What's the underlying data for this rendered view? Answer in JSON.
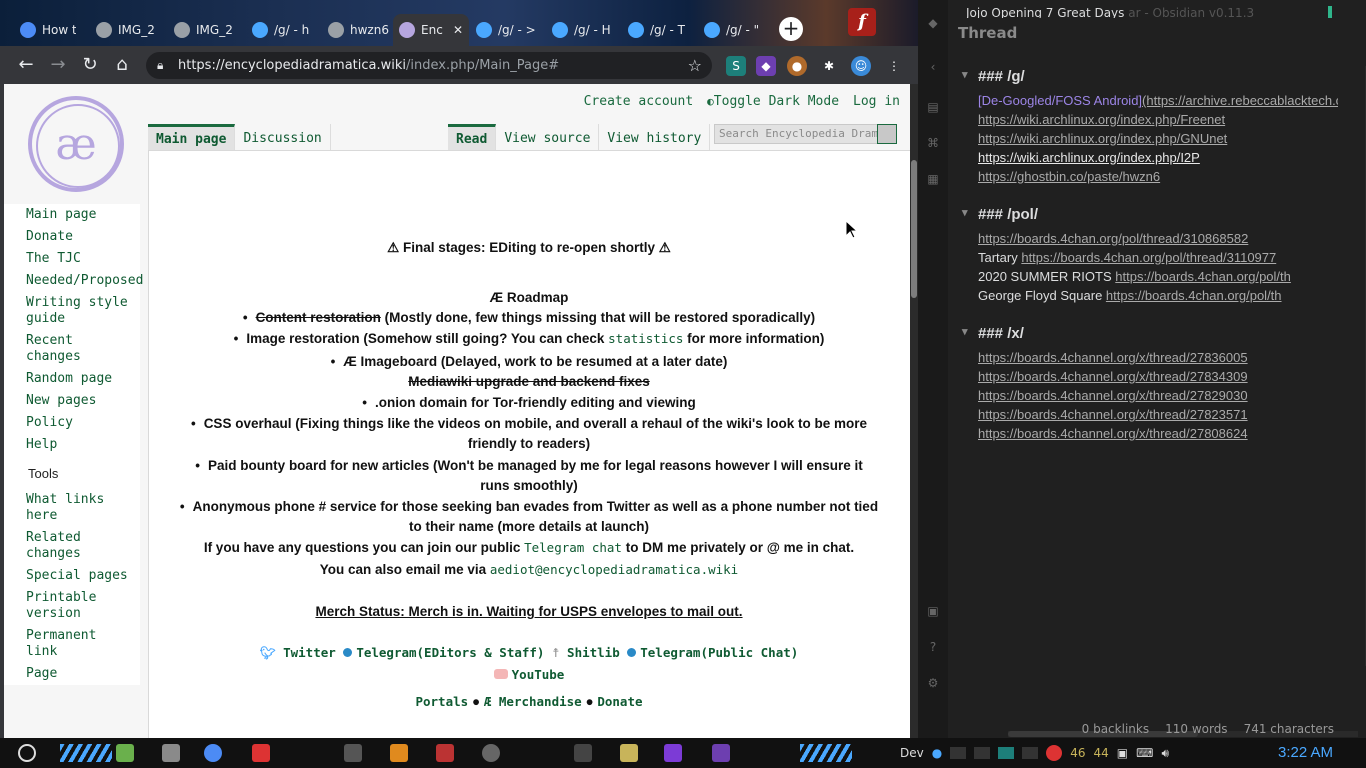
{
  "tabs": [
    {
      "title": "How to",
      "icon": "chrome-icon",
      "color": "#4c8bf5"
    },
    {
      "title": "IMG_2",
      "icon": "globe-icon",
      "color": "#9aa0a6"
    },
    {
      "title": "IMG_2",
      "icon": "globe-icon",
      "color": "#9aa0a6"
    },
    {
      "title": "/g/ - h",
      "icon": "4chan-icon",
      "color": "#4aa8ff"
    },
    {
      "title": "hwzn6",
      "icon": "ghost-icon",
      "color": "#9aa0a6"
    },
    {
      "title": "Enc",
      "icon": "ae-icon",
      "color": "#b6a6df",
      "active": true
    },
    {
      "title": "/g/ - >",
      "icon": "4chan-icon",
      "color": "#4aa8ff"
    },
    {
      "title": "/g/ - H",
      "icon": "4chan-icon",
      "color": "#4aa8ff"
    },
    {
      "title": "/g/ - T",
      "icon": "4chan-icon",
      "color": "#4aa8ff"
    },
    {
      "title": "/g/ - \"",
      "icon": "4chan-icon",
      "color": "#4aa8ff"
    }
  ],
  "address": {
    "host": "https://encyclopediadramatica.wiki",
    "path": "/index.php/Main_Page#"
  },
  "wiki": {
    "personal": {
      "create_account": "Create account",
      "dark_mode": "Toggle Dark Mode",
      "login": "Log in"
    },
    "ns_tabs": [
      "Main page",
      "Discussion"
    ],
    "view_tabs": [
      "Read",
      "View source",
      "View history"
    ],
    "search_placeholder": "Search Encyclopedia Drama",
    "sidebar": {
      "nav": [
        "Main page",
        "Donate",
        "The TJC",
        "Needed/Proposed",
        "Writing style guide",
        "Recent changes",
        "Random page",
        "New pages",
        "Policy",
        "Help"
      ],
      "tools_heading": "Tools",
      "tools": [
        "What links here",
        "Related changes",
        "Special pages",
        "Printable version",
        "Permanent link",
        "Page"
      ]
    },
    "article": {
      "notice": "⚠ Final stages: EDiting to re-open shortly ⚠",
      "roadmap_title": "Æ Roadmap",
      "item1_strike": "Content restoration",
      "item1_rest": " (Mostly done, few things missing that will be restored sporadically)",
      "item2_a": "Image restoration (Somehow still going? You can check ",
      "item2_link": "statistics",
      "item2_b": " for more information)",
      "item3": "Æ Imageboard (Delayed, work to be resumed at a later date)",
      "item4_strike": "Mediawiki upgrade and backend fixes",
      "item5": ".onion domain for Tor-friendly editing and viewing",
      "item6a": "CSS overhaul (Fixing things like the videos on mobile, and overall a rehaul of the wiki's look to be more",
      "item6b": "friendly to readers)",
      "item7a": "Paid bounty board for new articles (Won't be managed by me for legal reasons however I will ensure it",
      "item7b": "runs smoothly)",
      "item8a": "Anonymous phone # service for those seeking ban evades from Twitter as well as a phone number not tied",
      "item8b": "to their name (more details at launch)",
      "questions_a": "If you have any questions you can join our public ",
      "questions_link": "Telegram chat",
      "questions_b": " to DM me privately or @ me in chat.",
      "email_a": "You can also email me via ",
      "email_link": "aediot@encyclopediadramatica.wiki",
      "merch_status": "Merch Status: Merch is in. Waiting for USPS envelopes to mail out.",
      "social": [
        "Twitter",
        "Telegram(EDitors & Staff)",
        "Shitlib",
        "Telegram(Public Chat)"
      ],
      "youtube": "YouTube",
      "footer_links": [
        "Portals",
        "Æ Merchandise",
        "Donate"
      ]
    }
  },
  "obsidian": {
    "window_title": "Jojo Opening 7 Great Days",
    "window_title_faint": "ar - Obsidian v0.11.3",
    "pane_title": "Thread",
    "sections": [
      {
        "heading": "### /g/",
        "lines": [
          {
            "type": "md",
            "label": "[De-Googled/FOSS Android]",
            "url": "(https://archive.rebeccablacktech.com"
          },
          {
            "type": "link",
            "text": "https://wiki.archlinux.org/index.php/Freenet"
          },
          {
            "type": "link",
            "text": "https://wiki.archlinux.org/index.php/GNUnet"
          },
          {
            "type": "link_bright",
            "text": "https://wiki.archlinux.org/index.php/I2P"
          },
          {
            "type": "link",
            "text": "https://ghostbin.co/paste/hwzn6"
          }
        ]
      },
      {
        "heading": "### /pol/",
        "lines": [
          {
            "type": "link",
            "text": "https://boards.4chan.org/pol/thread/310868582"
          },
          {
            "type": "mixed",
            "label": "Tartary ",
            "url": "https://boards.4chan.org/pol/thread/3110977"
          },
          {
            "type": "mixed",
            "label": "2020 SUMMER RIOTS ",
            "url": "https://boards.4chan.org/pol/th"
          },
          {
            "type": "mixed",
            "label": "George Floyd Square ",
            "url": "https://boards.4chan.org/pol/th"
          }
        ]
      },
      {
        "heading": "### /x/",
        "lines": [
          {
            "type": "link",
            "text": "https://boards.4channel.org/x/thread/27836005"
          },
          {
            "type": "link",
            "text": "https://boards.4channel.org/x/thread/27834309"
          },
          {
            "type": "link",
            "text": "https://boards.4channel.org/x/thread/27829030"
          },
          {
            "type": "link",
            "text": "https://boards.4channel.org/x/thread/27823571"
          },
          {
            "type": "link",
            "text": "https://boards.4channel.org/x/thread/27808624"
          }
        ]
      }
    ],
    "status": {
      "backlinks": "0 backlinks",
      "words": "110 words",
      "chars": "741 characters"
    }
  },
  "taskbar": {
    "desktop_label": "Dev",
    "tray_numbers": [
      "46",
      "44"
    ],
    "clock": "3:22 AM"
  },
  "colors": {
    "wiki_link": "#0f5a32",
    "obsidian_bg": "#202020",
    "clock": "#4aa8ff"
  }
}
